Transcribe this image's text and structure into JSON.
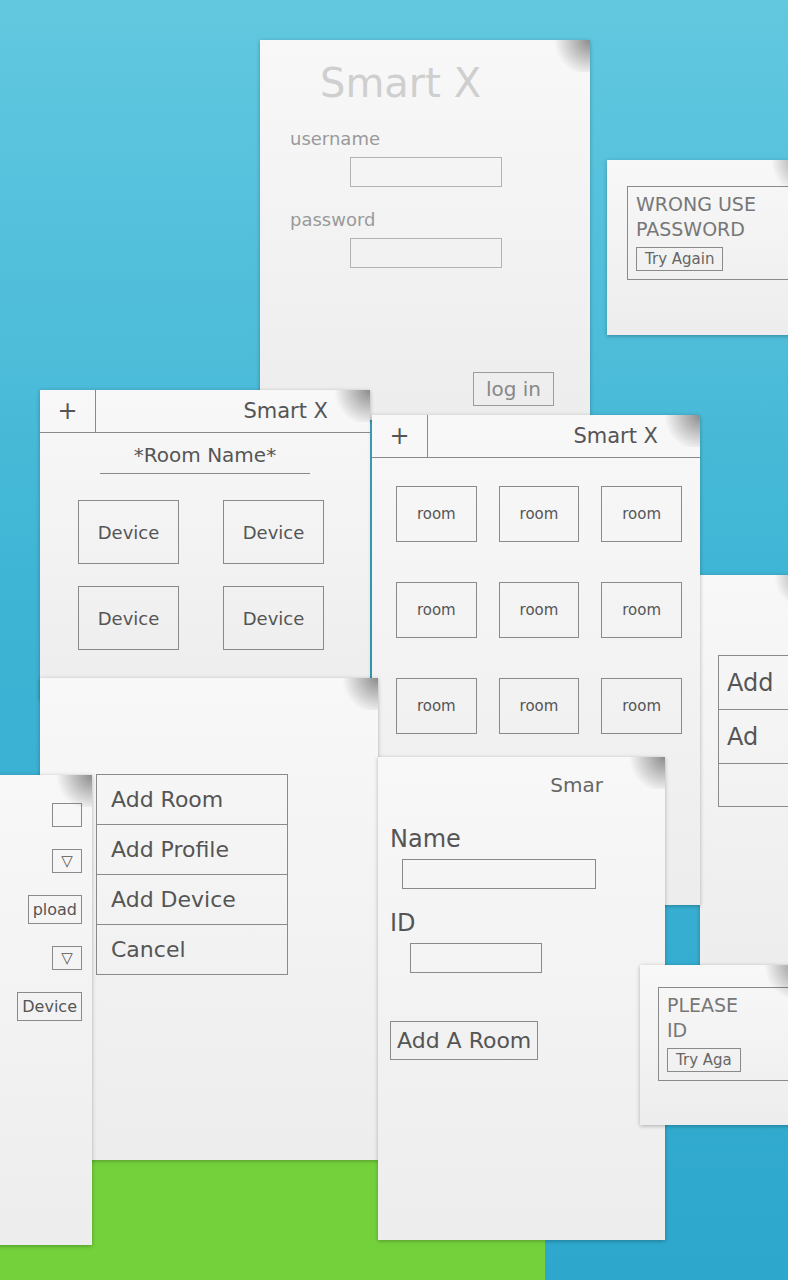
{
  "login": {
    "title": "Smart X",
    "username_label": "username",
    "password_label": "password",
    "button": "log in"
  },
  "login_error": {
    "lines": [
      "WRONG USE",
      "PASSWORD"
    ],
    "button": "Try Again"
  },
  "room_view": {
    "add": "+",
    "title": "Smart X",
    "room_name": "*Room Name*",
    "devices": [
      "Device",
      "Device",
      "Device",
      "Device"
    ]
  },
  "rooms_view": {
    "add": "+",
    "title": "Smart X",
    "rooms": [
      "room",
      "room",
      "room",
      "room",
      "room",
      "room",
      "room",
      "room",
      "room"
    ]
  },
  "menu": {
    "items": [
      "Add Room",
      "Add Profile",
      "Add Device",
      "Cancel"
    ]
  },
  "add_room_form": {
    "title": "Smar",
    "fields": [
      {
        "label": "Name"
      },
      {
        "label": "ID"
      }
    ],
    "button": "Add A Room"
  },
  "id_error": {
    "lines": [
      "PLEASE",
      "ID"
    ],
    "button": "Try Aga"
  },
  "left_partial": {
    "rows": [
      {
        "kind": "dropdown",
        "text": "▽"
      },
      {
        "kind": "button",
        "text": "pload"
      },
      {
        "kind": "dropdown",
        "text": "▽"
      },
      {
        "kind": "button",
        "text": "Device"
      }
    ]
  },
  "right_partial": {
    "items": [
      "Add",
      "Ad"
    ]
  }
}
